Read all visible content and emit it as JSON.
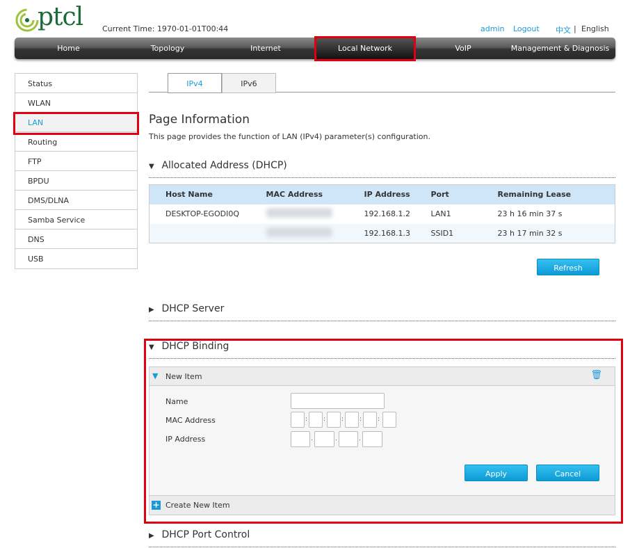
{
  "header": {
    "logo": "ptcl",
    "current_time_label": "Current Time:",
    "current_time": "1970-01-01T00:44",
    "user": "admin",
    "logout": "Logout",
    "lang_zh": "中文",
    "lang_sep": "|",
    "lang_en": "English"
  },
  "nav": [
    "Home",
    "Topology",
    "Internet",
    "Local Network",
    "VoIP",
    "Management & Diagnosis"
  ],
  "sidebar": [
    "Status",
    "WLAN",
    "LAN",
    "Routing",
    "FTP",
    "BPDU",
    "DMS/DLNA",
    "Samba Service",
    "DNS",
    "USB"
  ],
  "tabs": [
    "IPv4",
    "IPv6"
  ],
  "page": {
    "title": "Page Information",
    "description": "This page provides the function of LAN (IPv4) parameter(s) configuration."
  },
  "allocated": {
    "title": "Allocated Address (DHCP)",
    "columns": [
      "Host Name",
      "MAC Address",
      "IP Address",
      "Port",
      "Remaining Lease"
    ],
    "rows": [
      {
        "host": "DESKTOP-EGODI0Q",
        "ip": "192.168.1.2",
        "port": "LAN1",
        "lease": "23 h 16 min 37 s"
      },
      {
        "host": "",
        "ip": "192.168.1.3",
        "port": "SSID1",
        "lease": "23 h 17 min 32 s"
      }
    ],
    "refresh": "Refresh"
  },
  "dhcp_server": "DHCP Server",
  "dhcp_binding": {
    "title": "DHCP Binding",
    "item": "New Item",
    "name_label": "Name",
    "mac_label": "MAC Address",
    "ip_label": "IP Address",
    "apply": "Apply",
    "cancel": "Cancel",
    "create": "Create New Item"
  },
  "dhcp_port_control": "DHCP Port Control",
  "colors": {
    "accent": "#1a9ad6",
    "highlight": "#e00010"
  }
}
